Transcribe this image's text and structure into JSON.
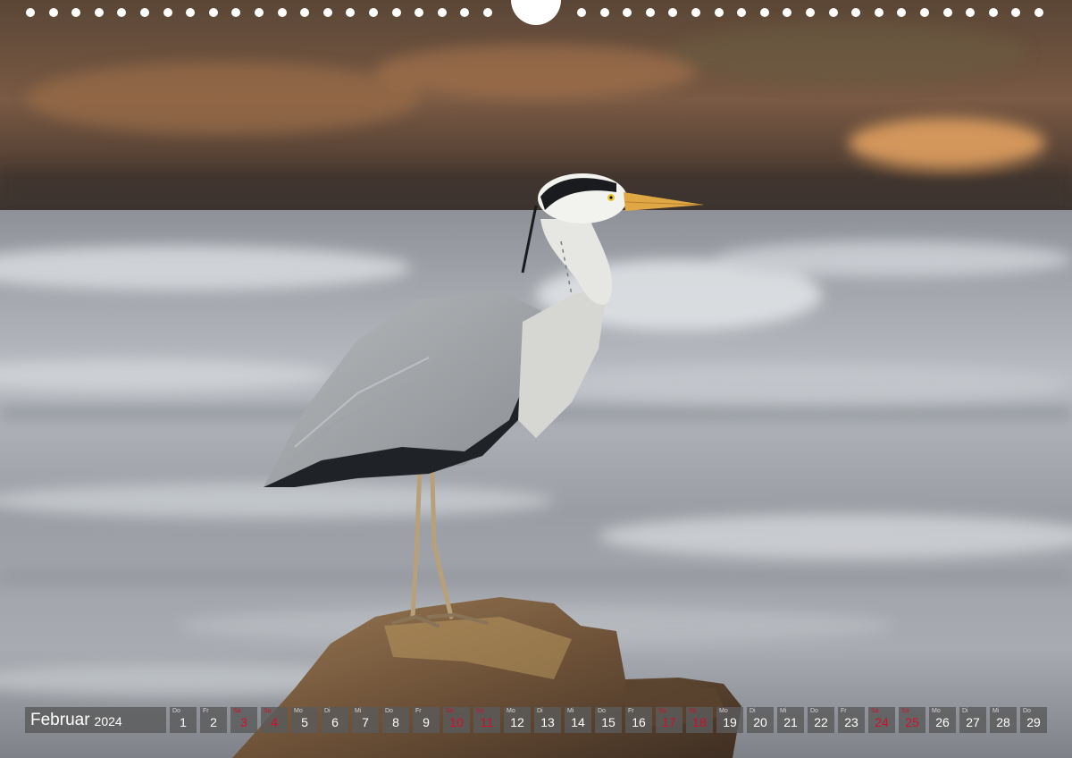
{
  "calendar": {
    "month": "Februar",
    "year": "2024",
    "days": [
      {
        "dow": "Do",
        "num": "1",
        "holiday": false
      },
      {
        "dow": "Fr",
        "num": "2",
        "holiday": false
      },
      {
        "dow": "Sa",
        "num": "3",
        "holiday": true
      },
      {
        "dow": "So",
        "num": "4",
        "holiday": true
      },
      {
        "dow": "Mo",
        "num": "5",
        "holiday": false
      },
      {
        "dow": "Di",
        "num": "6",
        "holiday": false
      },
      {
        "dow": "Mi",
        "num": "7",
        "holiday": false
      },
      {
        "dow": "Do",
        "num": "8",
        "holiday": false
      },
      {
        "dow": "Fr",
        "num": "9",
        "holiday": false
      },
      {
        "dow": "Sa",
        "num": "10",
        "holiday": true
      },
      {
        "dow": "So",
        "num": "11",
        "holiday": true
      },
      {
        "dow": "Mo",
        "num": "12",
        "holiday": false
      },
      {
        "dow": "Di",
        "num": "13",
        "holiday": false
      },
      {
        "dow": "Mi",
        "num": "14",
        "holiday": false
      },
      {
        "dow": "Do",
        "num": "15",
        "holiday": false
      },
      {
        "dow": "Fr",
        "num": "16",
        "holiday": false
      },
      {
        "dow": "Sa",
        "num": "17",
        "holiday": true
      },
      {
        "dow": "So",
        "num": "18",
        "holiday": true
      },
      {
        "dow": "Mo",
        "num": "19",
        "holiday": false
      },
      {
        "dow": "Di",
        "num": "20",
        "holiday": false
      },
      {
        "dow": "Mi",
        "num": "21",
        "holiday": false
      },
      {
        "dow": "Do",
        "num": "22",
        "holiday": false
      },
      {
        "dow": "Fr",
        "num": "23",
        "holiday": false
      },
      {
        "dow": "Sa",
        "num": "24",
        "holiday": true
      },
      {
        "dow": "So",
        "num": "25",
        "holiday": true
      },
      {
        "dow": "Mo",
        "num": "26",
        "holiday": false
      },
      {
        "dow": "Di",
        "num": "27",
        "holiday": false
      },
      {
        "dow": "Mi",
        "num": "28",
        "holiday": false
      },
      {
        "dow": "Do",
        "num": "29",
        "holiday": false
      }
    ]
  },
  "colors": {
    "holiday_text": "#d0102a",
    "cell_background": "#5a5a5a",
    "binding_holes": "#ffffff"
  }
}
